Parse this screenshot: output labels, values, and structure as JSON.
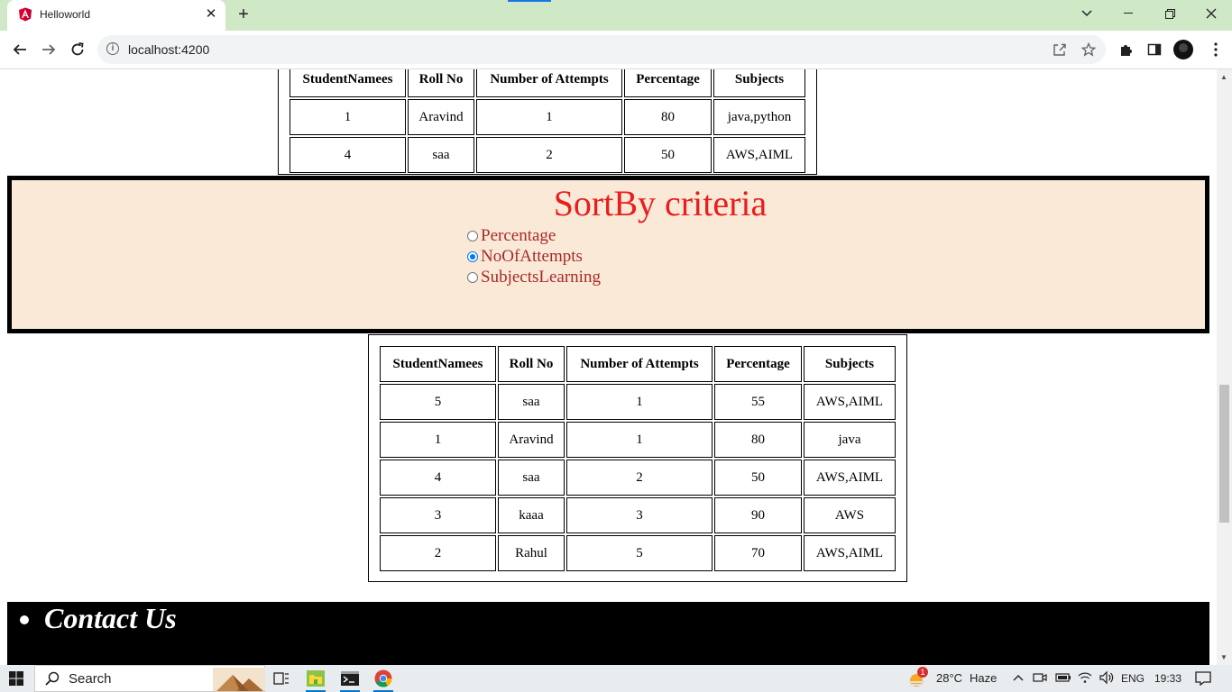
{
  "browser": {
    "tab_title": "Helloworld",
    "url": "localhost:4200"
  },
  "table_top": {
    "headers": [
      "StudentNamees",
      "Roll No",
      "Number of Attempts",
      "Percentage",
      "Subjects"
    ],
    "rows": [
      [
        "1",
        "Aravind",
        "1",
        "80",
        "java,python"
      ],
      [
        "4",
        "saa",
        "2",
        "50",
        "AWS,AIML"
      ]
    ]
  },
  "sort": {
    "title": "SortBy criteria",
    "options": [
      {
        "label": "Percentage",
        "checked": false
      },
      {
        "label": "NoOfAttempts",
        "checked": true
      },
      {
        "label": "SubjectsLearning",
        "checked": false
      }
    ]
  },
  "table_main": {
    "headers": [
      "StudentNamees",
      "Roll No",
      "Number of Attempts",
      "Percentage",
      "Subjects"
    ],
    "rows": [
      [
        "5",
        "saa",
        "1",
        "55",
        "AWS,AIML"
      ],
      [
        "1",
        "Aravind",
        "1",
        "80",
        "java"
      ],
      [
        "4",
        "saa",
        "2",
        "50",
        "AWS,AIML"
      ],
      [
        "3",
        "kaaa",
        "3",
        "90",
        "AWS"
      ],
      [
        "2",
        "Rahul",
        "5",
        "70",
        "AWS,AIML"
      ]
    ]
  },
  "footer": {
    "contact_label": "Contact Us"
  },
  "taskbar": {
    "search_label": "Search",
    "weather_temp": "28°C",
    "weather_desc": "Haze",
    "weather_badge": "1",
    "language": "ENG",
    "time": "19:33"
  }
}
